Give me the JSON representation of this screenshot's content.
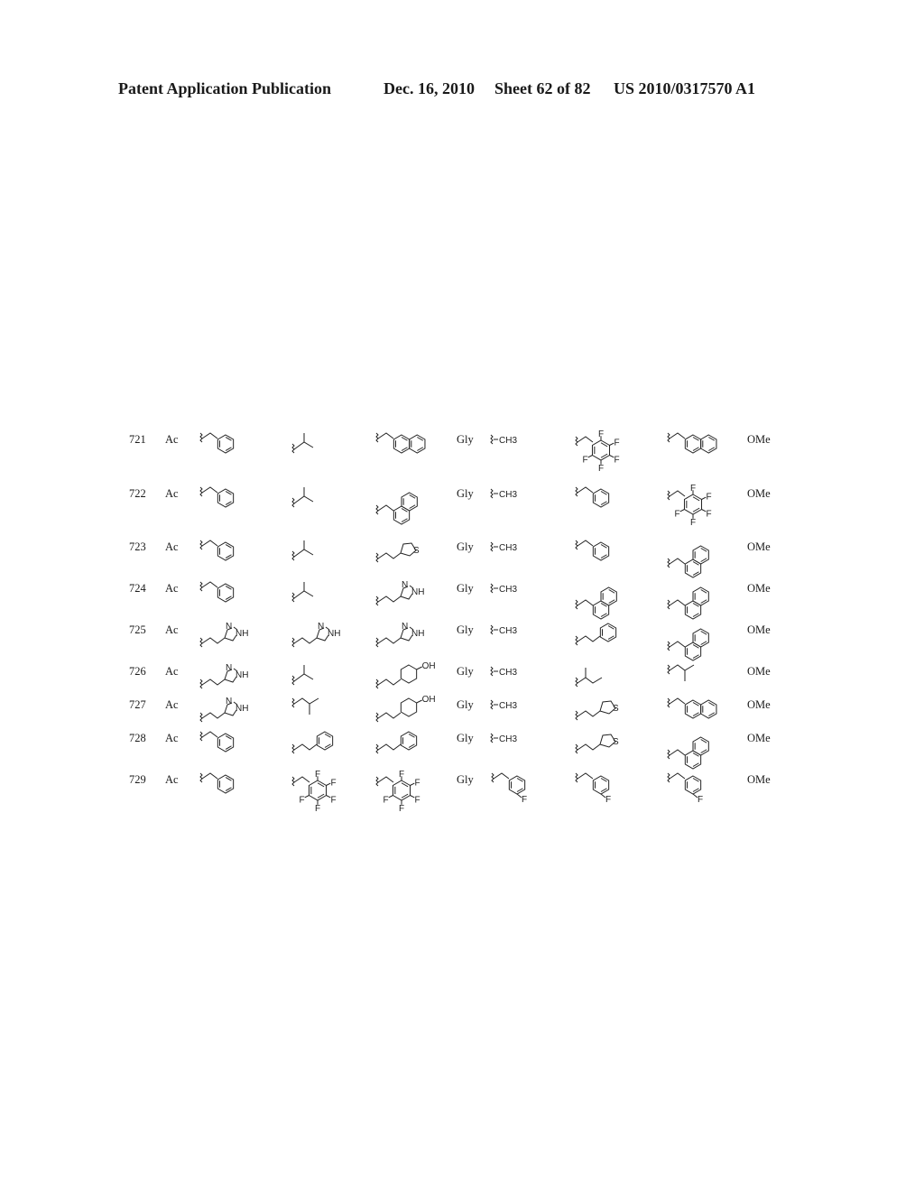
{
  "header": {
    "publication": "Patent Application Publication",
    "date": "Dec. 16, 2010",
    "sheet": "Sheet 62 of 82",
    "number": "US 2010/0317570 A1"
  },
  "table": {
    "rows": [
      {
        "id": "721",
        "col1": "Ac",
        "r1": "benzyl",
        "r2": "isopropyl",
        "r3": "2-naphthylmethyl",
        "col5": "Gly",
        "r4": "methyl",
        "r5": "pentafluorobenzyl",
        "r6": "2-naphthylmethyl",
        "col9": "OMe"
      },
      {
        "id": "722",
        "col1": "Ac",
        "r1": "benzyl",
        "r2": "isopropyl",
        "r3": "1-naphthylmethyl",
        "col5": "Gly",
        "r4": "methyl",
        "r5": "benzyl",
        "r6": "pentafluorobenzyl",
        "col9": "OMe"
      },
      {
        "id": "723",
        "col1": "Ac",
        "r1": "benzyl",
        "r2": "isopropyl",
        "r3": "3-thienylethyl",
        "col5": "Gly",
        "r4": "methyl",
        "r5": "benzyl",
        "r6": "1-naphthylmethyl",
        "col9": "OMe"
      },
      {
        "id": "724",
        "col1": "Ac",
        "r1": "benzyl",
        "r2": "isopropyl",
        "r3": "imidazolylethyl",
        "col5": "Gly",
        "r4": "methyl",
        "r5": "1-naphthylmethyl",
        "r6": "1-naphthylmethyl",
        "col9": "OMe"
      },
      {
        "id": "725",
        "col1": "Ac",
        "r1": "imidazolylethyl",
        "r2": "imidazolylethyl",
        "r3": "imidazolylethyl",
        "col5": "Gly",
        "r4": "methyl",
        "r5": "phenethyl",
        "r6": "1-naphthylmethyl",
        "col9": "OMe"
      },
      {
        "id": "726",
        "col1": "Ac",
        "r1": "imidazolylethyl",
        "r2": "isopropyl",
        "r3": "4-hydroxyphenethyl",
        "col5": "Gly",
        "r4": "methyl",
        "r5": "sec-butyl",
        "r6": "isobutyl",
        "col9": "OMe"
      },
      {
        "id": "727",
        "col1": "Ac",
        "r1": "imidazolylethyl",
        "r2": "isobutyl",
        "r3": "4-hydroxyphenethyl",
        "col5": "Gly",
        "r4": "methyl",
        "r5": "3-thienylethyl",
        "r6": "2-naphthylmethyl",
        "col9": "OMe"
      },
      {
        "id": "728",
        "col1": "Ac",
        "r1": "benzyl",
        "r2": "phenethyl",
        "r3": "phenethyl",
        "col5": "Gly",
        "r4": "methyl",
        "r5": "3-thienylethyl",
        "r6": "1-naphthylmethyl",
        "col9": "OMe"
      },
      {
        "id": "729",
        "col1": "Ac",
        "r1": "benzyl",
        "r2": "pentafluorobenzyl",
        "r3": "pentafluorobenzyl",
        "col5": "Gly",
        "r4": "4-fluorobenzyl",
        "r5": "4-fluorobenzyl",
        "r6": "4-fluorobenzyl",
        "col9": "OMe"
      }
    ]
  },
  "labels": {
    "methyl": "CH3",
    "fluoro": "F",
    "nh": "NH",
    "n": "N",
    "s": "S",
    "oh": "OH"
  }
}
